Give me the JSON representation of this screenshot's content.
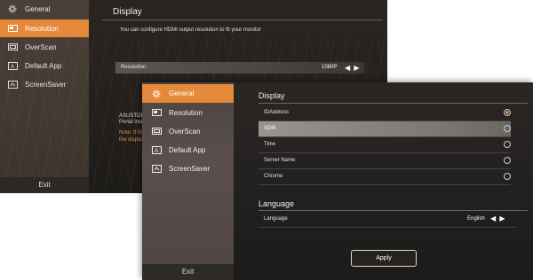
{
  "back_window": {
    "sidebar": {
      "items": [
        {
          "label": "General",
          "icon": "gear-icon"
        },
        {
          "label": "Resolution",
          "icon": "monitor-icon",
          "active": true
        },
        {
          "label": "OverScan",
          "icon": "overscan-icon"
        },
        {
          "label": "Default App",
          "icon": "app-icon"
        },
        {
          "label": "ScreenSaver",
          "icon": "screensaver-icon"
        }
      ],
      "exit_label": "Exit"
    },
    "title": "Display",
    "description": "You can configure  HDMI output resolution to  fit your monitor",
    "resolution": {
      "label": "Resolution",
      "value": "1080P",
      "arrows": "◀ ▶"
    },
    "asustor_label": "ASUSTOR",
    "portal_label": "Portal inst",
    "note_line1": "Note: If th",
    "note_line2": "the display"
  },
  "front_window": {
    "sidebar": {
      "items": [
        {
          "label": "General",
          "icon": "gear-icon",
          "active": true
        },
        {
          "label": "Resolution",
          "icon": "monitor-icon"
        },
        {
          "label": "OverScan",
          "icon": "overscan-icon"
        },
        {
          "label": "Default App",
          "icon": "app-icon"
        },
        {
          "label": "ScreenSaver",
          "icon": "screensaver-icon"
        }
      ],
      "exit_label": "Exit"
    },
    "display": {
      "title": "Display",
      "options": [
        {
          "label": "IDAddress",
          "selected": true
        },
        {
          "label": "ADM",
          "selected": false
        },
        {
          "label": "Time",
          "selected": false
        },
        {
          "label": "Server Name",
          "selected": false
        },
        {
          "label": "Chrome",
          "selected": false
        }
      ]
    },
    "language": {
      "title": "Language",
      "row_label": "Language",
      "value": "English",
      "arrows": "◀ ▶"
    },
    "apply_label": "Apply"
  },
  "colors": {
    "accent": "#e6893b"
  }
}
